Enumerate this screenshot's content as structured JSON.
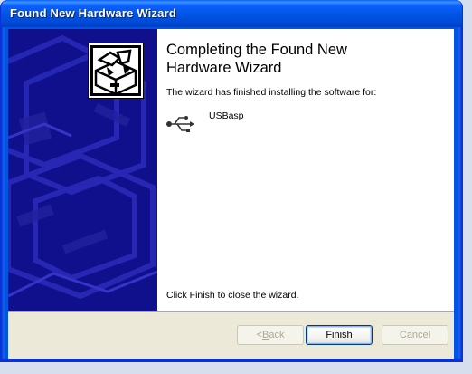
{
  "window": {
    "title": "Found New Hardware Wizard"
  },
  "content": {
    "heading_line1": "Completing the Found New",
    "heading_line2": "Hardware Wizard",
    "finished_text": "The wizard has finished installing the software for:",
    "device_name": "USBasp",
    "close_instruction": "Click Finish to close the wizard."
  },
  "buttons": {
    "back_prefix": "< ",
    "back_accel": "B",
    "back_rest": "ack",
    "finish": "Finish",
    "cancel": "Cancel"
  },
  "icons": {
    "wizard": "hardware-box-icon",
    "device": "usb-icon"
  },
  "colors": {
    "titlebar": "#0054e3",
    "side_panel": "#10108c",
    "dialog_face": "#ece9d8"
  }
}
